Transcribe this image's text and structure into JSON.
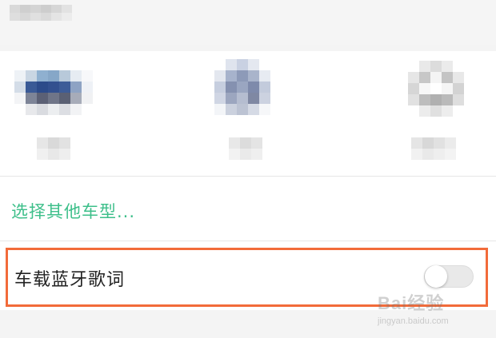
{
  "vehicles": [
    {
      "label": ""
    },
    {
      "label": ""
    },
    {
      "label": ""
    }
  ],
  "other_models": {
    "label": "选择其他车型..."
  },
  "bluetooth_lyrics": {
    "label": "车载蓝牙歌词",
    "enabled": false
  },
  "colors": {
    "accent": "#3dbf8a",
    "highlight": "#f26b3a",
    "text": "#222222"
  },
  "watermark": {
    "brand": "Bai经验",
    "url": "jingyan.baidu.com"
  }
}
